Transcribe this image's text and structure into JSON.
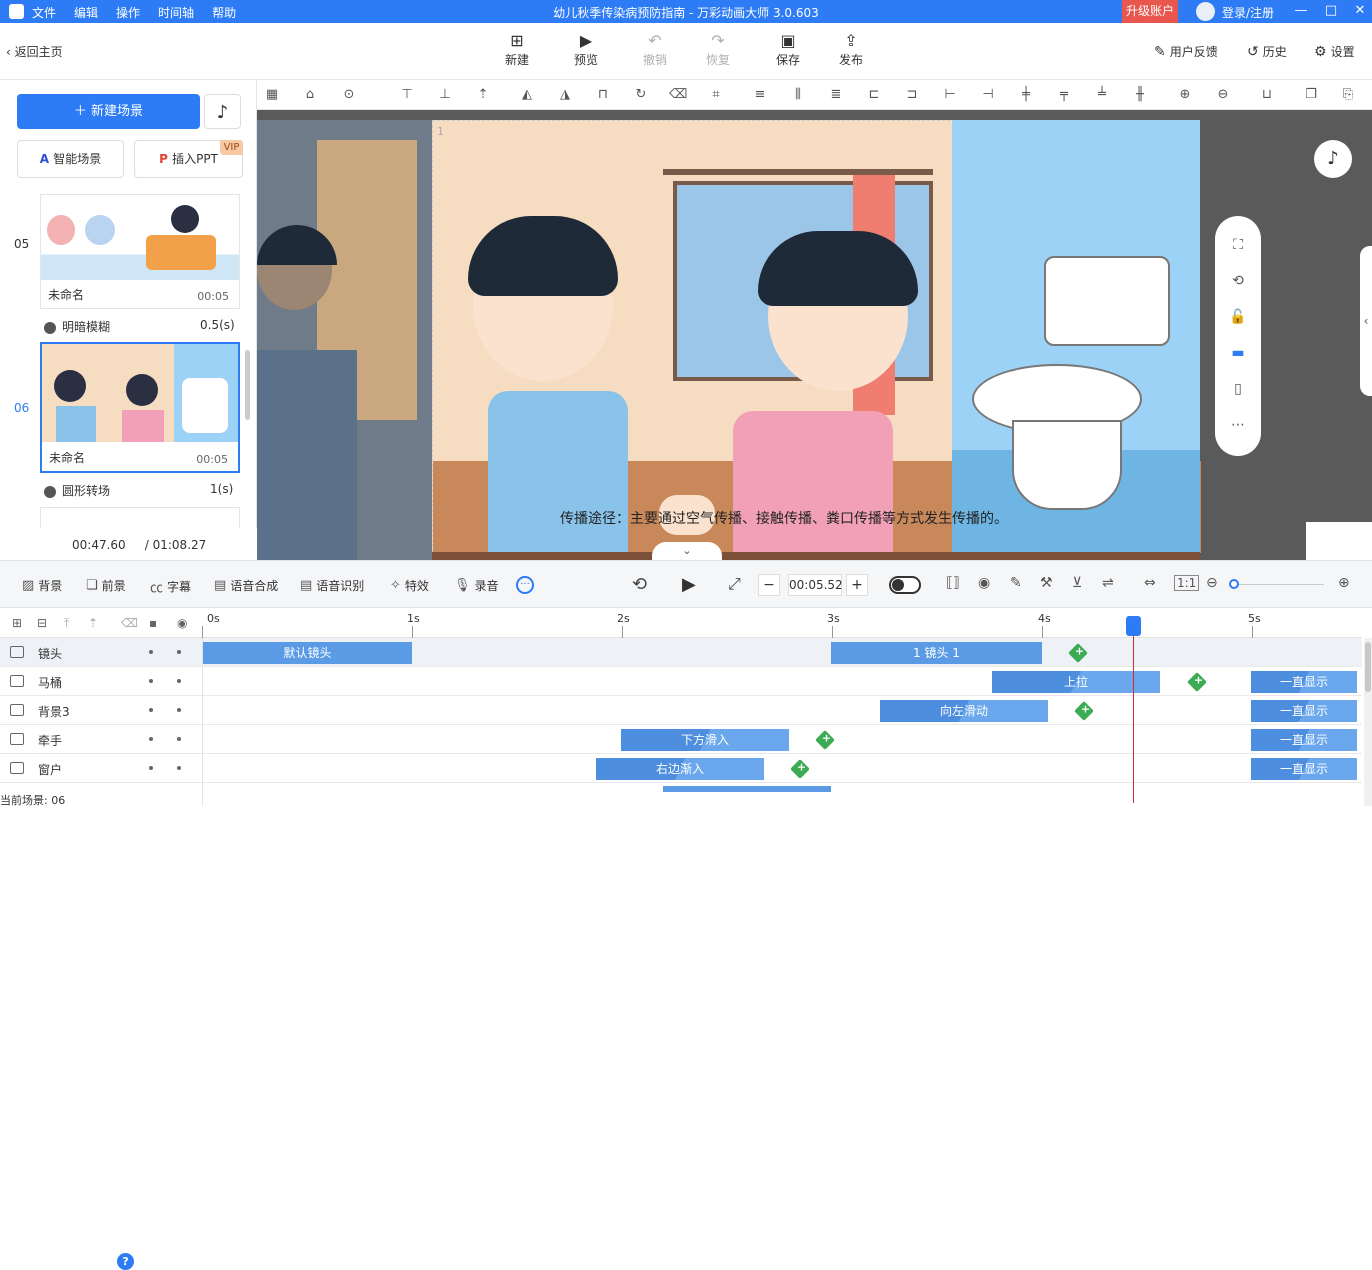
{
  "app": {
    "menu": [
      "文件",
      "编辑",
      "操作",
      "时间轴",
      "帮助"
    ],
    "title": "幼儿秋季传染病预防指南 - 万彩动画大师 3.0.603",
    "upgrade": "升级账户",
    "login": "登录/注册",
    "window_controls": [
      "—",
      "□",
      "✕"
    ]
  },
  "toolbar": {
    "back": "返回主页",
    "buttons": [
      {
        "label": "新建",
        "icon": "new-icon"
      },
      {
        "label": "预览",
        "icon": "play-icon"
      },
      {
        "label": "撤销",
        "icon": "undo-icon",
        "disabled": true
      },
      {
        "label": "恢复",
        "icon": "redo-icon",
        "disabled": true
      },
      {
        "label": "保存",
        "icon": "save-icon"
      },
      {
        "label": "发布",
        "icon": "publish-icon"
      }
    ],
    "right": {
      "feedback": "用户反馈",
      "history": "历史",
      "settings": "设置"
    }
  },
  "left": {
    "new_scene": "＋ 新建场景",
    "smart_scene": "智能场景",
    "insert_ppt": "插入PPT",
    "vip": "VIP",
    "scenes": [
      {
        "num": "05",
        "name": "未命名",
        "duration": "00:05",
        "transition": "明暗模糊",
        "transition_value": "0.5(s)"
      },
      {
        "num": "06",
        "name": "未命名",
        "duration": "00:05",
        "transition": "圆形转场",
        "transition_value": "1(s)",
        "selected": true
      }
    ],
    "time_current": "00:47.60",
    "time_total": "/ 01:08.27"
  },
  "canvas": {
    "subtitle": "传播途径：主要通过空气传播、接触传播、粪口传播等方式发生传播的。",
    "frame_label": "1"
  },
  "midbar": {
    "tools": [
      "背景",
      "前景",
      "字幕",
      "语音合成",
      "语音识别",
      "特效",
      "录音"
    ],
    "time": "00:05.52",
    "minus": "−",
    "plus": "+"
  },
  "timeline": {
    "ticks": [
      "0s",
      "1s",
      "2s",
      "3s",
      "4s",
      "5s"
    ],
    "rows": [
      {
        "name": "镜头",
        "clips": [
          {
            "label": "默认镜头"
          },
          {
            "label": "1 镜头 1"
          }
        ]
      },
      {
        "name": "马桶",
        "clips": [
          {
            "label": "上拉"
          },
          {
            "label": "一直显示"
          }
        ]
      },
      {
        "name": "背景3",
        "clips": [
          {
            "label": "向左滑动"
          },
          {
            "label": "一直显示"
          }
        ]
      },
      {
        "name": "牵手",
        "clips": [
          {
            "label": "下方滑入"
          },
          {
            "label": "一直显示"
          }
        ]
      },
      {
        "name": "窗户",
        "clips": [
          {
            "label": "右边渐入"
          },
          {
            "label": "一直显示"
          }
        ]
      }
    ],
    "current_scene": "当前场景: 06"
  }
}
